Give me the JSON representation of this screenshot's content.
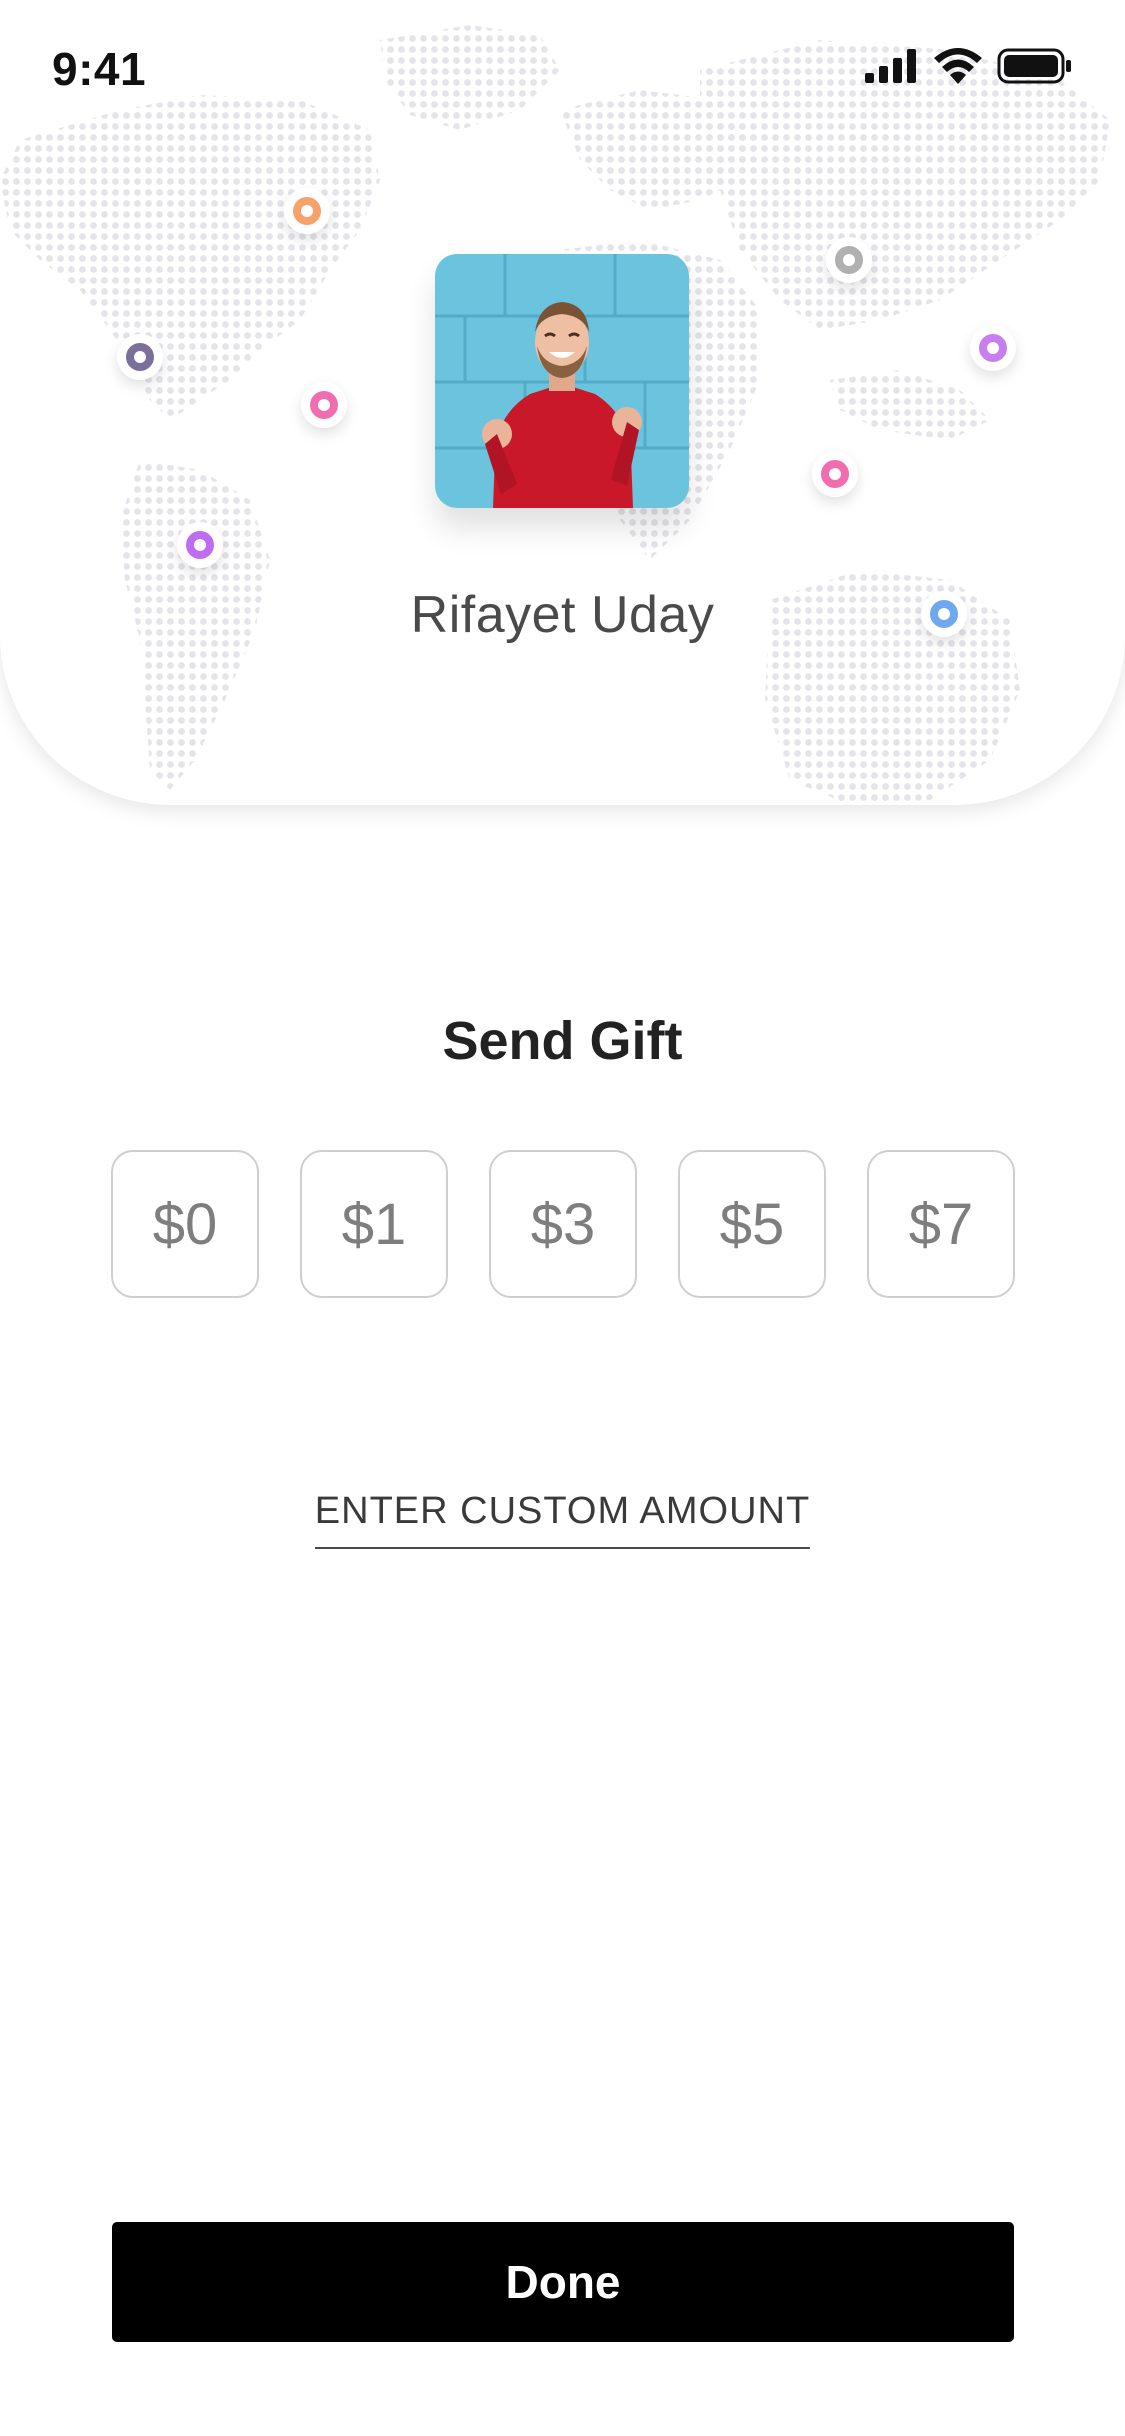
{
  "status_bar": {
    "time": "9:41",
    "icons": [
      "cellular-signal-icon",
      "wifi-icon",
      "battery-icon"
    ]
  },
  "profile": {
    "name": "Rifayet Uday",
    "photo": "profile-photo"
  },
  "map": {
    "pin_colors": [
      "#f5a26b",
      "#b0b0b0",
      "#7c6f9a",
      "#f06eaf",
      "#c77ff0",
      "#f06eaf",
      "#c06cf0",
      "#6fa8f0"
    ]
  },
  "gift": {
    "title": "Send Gift",
    "amounts": [
      "$0",
      "$1",
      "$3",
      "$5",
      "$7"
    ],
    "custom_amount_label": "ENTER CUSTOM AMOUNT"
  },
  "actions": {
    "done_label": "Done"
  },
  "colors": {
    "primary_button": "#000000",
    "amount_text": "#7e7e7e"
  }
}
